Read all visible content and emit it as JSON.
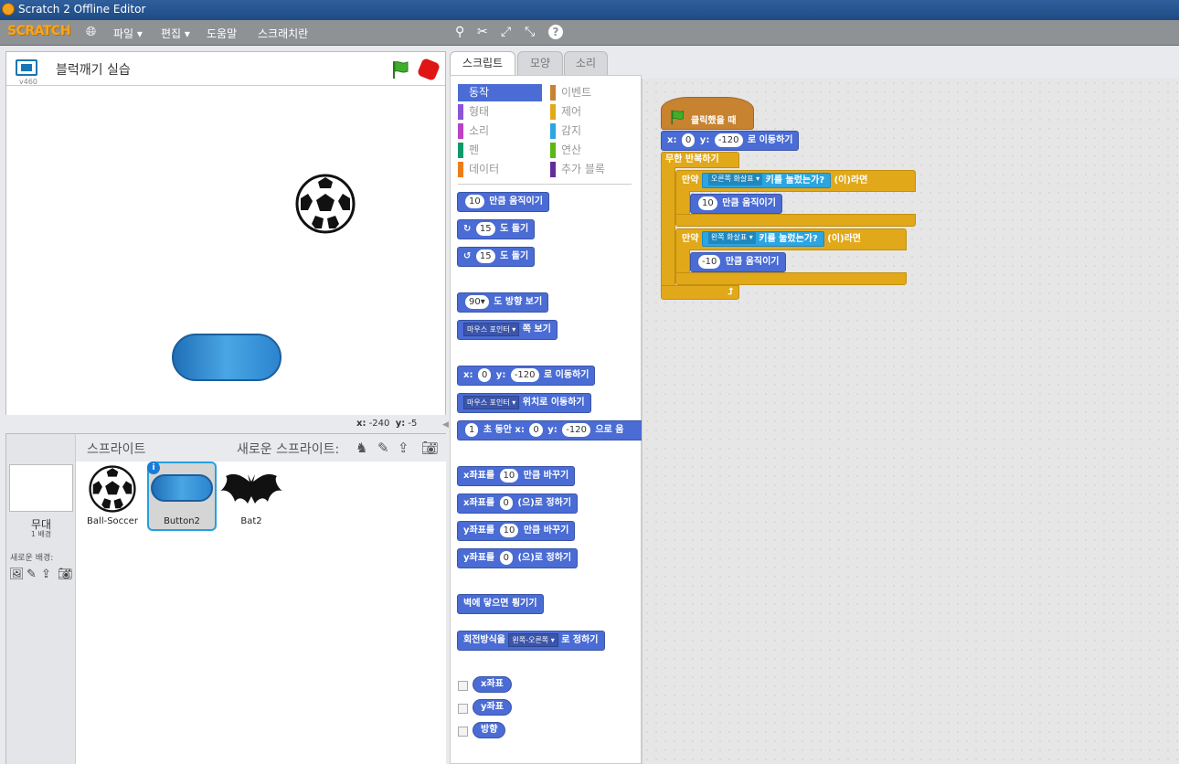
{
  "window": {
    "title": "Scratch 2 Offline Editor"
  },
  "menubar": {
    "logo": "SCRATCH",
    "items": [
      "파일 ▾",
      "편집 ▾",
      "도움말",
      "스크래치란"
    ]
  },
  "stage": {
    "version": "v460",
    "project_title": "블럭깨기 실습",
    "coords": {
      "x_label": "x:",
      "x_value": "-240",
      "y_label": "y:",
      "y_value": "-5"
    }
  },
  "sprite_pane": {
    "stage_label": "무대",
    "backdrop_count": "1 배경",
    "new_backdrop_label": "새로운 배경:",
    "sprites_title": "스프라이트",
    "new_sprite_label": "새로운 스프라이트:",
    "sprites": [
      {
        "name": "Ball-Soccer"
      },
      {
        "name": "Button2"
      },
      {
        "name": "Bat2"
      }
    ]
  },
  "tabs": [
    "스크립트",
    "모양",
    "소리"
  ],
  "palette": {
    "categories_left": [
      {
        "label": "동작",
        "color": "#4a6cd4"
      },
      {
        "label": "형태",
        "color": "#8a55d7"
      },
      {
        "label": "소리",
        "color": "#bb42c3"
      },
      {
        "label": "펜",
        "color": "#0e9a6c"
      },
      {
        "label": "데이터",
        "color": "#ee7d16"
      }
    ],
    "categories_right": [
      {
        "label": "이벤트",
        "color": "#c88330"
      },
      {
        "label": "제어",
        "color": "#e1a91a"
      },
      {
        "label": "감지",
        "color": "#2ca5e2"
      },
      {
        "label": "연산",
        "color": "#5cb712"
      },
      {
        "label": "추가 블록",
        "color": "#632d99"
      }
    ],
    "blocks": {
      "move_num": "10",
      "move_txt": "만큼 움직이기",
      "turn_r_num": "15",
      "turn_r_txt": "도 돌기",
      "turn_l_num": "15",
      "turn_l_txt": "도 돌기",
      "point_dir_num": "90▾",
      "point_dir_txt": "도 방향 보기",
      "point_to_drop": "마우스 포인터 ▾",
      "point_to_txt": "쪽 보기",
      "goto_x_lbl": "x:",
      "goto_x": "0",
      "goto_y_lbl": "y:",
      "goto_y": "-120",
      "goto_txt": "로 이동하기",
      "goto_drop": "마우스 포인터 ▾",
      "goto_drop_txt": "위치로 이동하기",
      "glide_num": "1",
      "glide_txt1": "초 동안 x:",
      "glide_x": "0",
      "glide_y_lbl": "y:",
      "glide_y": "-120",
      "glide_txt2": "으로 움",
      "chx_lbl": "x좌표를",
      "chx_num": "10",
      "chx_txt": "만큼 바꾸기",
      "setx_lbl": "x좌표를",
      "setx_num": "0",
      "setx_txt": "(으)로 정하기",
      "chy_lbl": "y좌표를",
      "chy_num": "10",
      "chy_txt": "만큼 바꾸기",
      "sety_lbl": "y좌표를",
      "sety_num": "0",
      "sety_txt": "(으)로 정하기",
      "bounce": "벽에 닿으면 튕기기",
      "rot_lbl": "회전방식을",
      "rot_drop": "왼쪽-오른쪽 ▾",
      "rot_txt": "로 정하기",
      "rep_x": "x좌표",
      "rep_y": "y좌표",
      "rep_dir": "방향"
    }
  },
  "script": {
    "hat_label": "클릭했을 때",
    "goto_x_lbl": "x:",
    "goto_x": "0",
    "goto_y_lbl": "y:",
    "goto_y": "-120",
    "goto_txt": "로 이동하기",
    "forever": "무한 반복하기",
    "if1_lbl": "만약",
    "if1_key": "오른쪽 화살표 ▾",
    "if1_txt": "키를 눌렀는가?",
    "if1_then": "(이)라면",
    "move1_num": "10",
    "move1_txt": "만큼 움직이기",
    "if2_lbl": "만약",
    "if2_key": "왼쪽 화살표 ▾",
    "if2_txt": "키를 눌렀는가?",
    "if2_then": "(이)라면",
    "move2_num": "-10",
    "move2_txt": "만큼 움직이기"
  }
}
